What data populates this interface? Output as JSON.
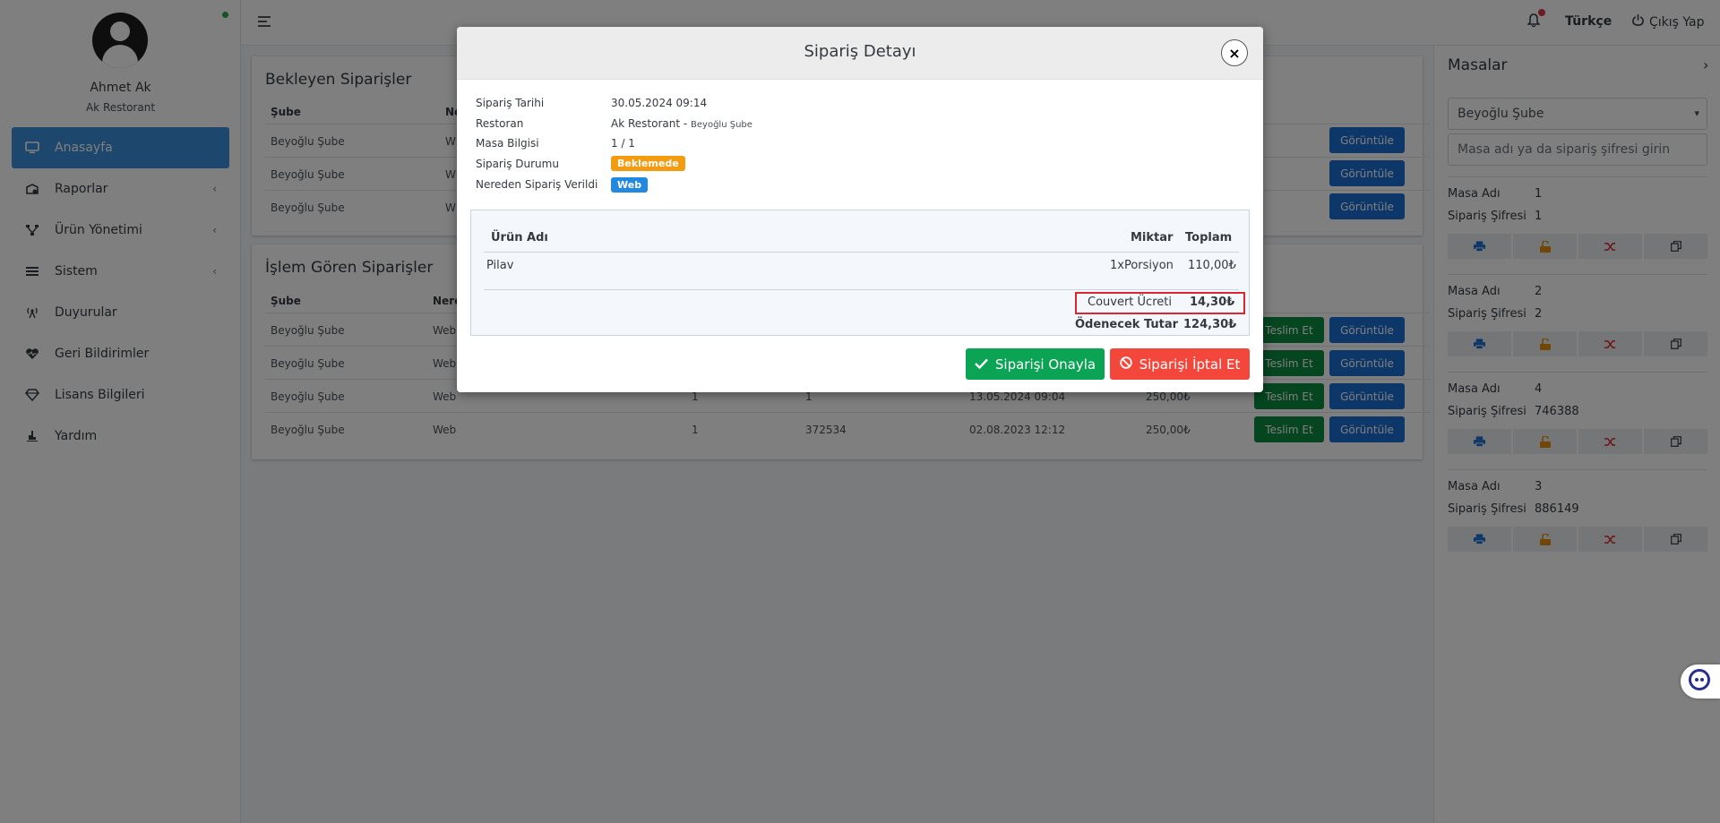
{
  "sidebar": {
    "user_name": "Ahmet Ak",
    "restaurant": "Ak Restorant",
    "items": [
      {
        "label": "Anasayfa",
        "icon": "monitor-icon",
        "active": true
      },
      {
        "label": "Raporlar",
        "icon": "chart-icon"
      },
      {
        "label": "Ürün Yönetimi",
        "icon": "sitemap-icon"
      },
      {
        "label": "Sistem",
        "icon": "list-icon"
      },
      {
        "label": "Duyurular",
        "icon": "broadcast-icon"
      },
      {
        "label": "Geri Bildirimler",
        "icon": "heart-pulse-icon"
      },
      {
        "label": "Lisans Bilgileri",
        "icon": "diamond-icon"
      },
      {
        "label": "Yardım",
        "icon": "hand-icon"
      }
    ]
  },
  "topbar": {
    "language": "Türkçe",
    "logout": "Çıkış Yap"
  },
  "pending": {
    "title": "Bekleyen Siparişler",
    "col_sube": "Şube",
    "col_nereden": "Ne",
    "rows": [
      {
        "sube": "Beyoğlu Şube",
        "from": "W"
      },
      {
        "sube": "Beyoğlu Şube",
        "from": "W"
      },
      {
        "sube": "Beyoğlu Şube",
        "from": "W"
      }
    ],
    "view_label": "Görüntüle"
  },
  "processing": {
    "title": "İşlem Gören Siparişler",
    "col_sube": "Şube",
    "col_nereden": "Nere",
    "rows": [
      {
        "sube": "Beyoğlu Şube",
        "from": "Web",
        "masa": "",
        "sifre": "",
        "date": "",
        "total": ""
      },
      {
        "sube": "Beyoğlu Şube",
        "from": "Web",
        "masa": "",
        "sifre": "",
        "date": "",
        "total": ""
      },
      {
        "sube": "Beyoğlu Şube",
        "from": "Web",
        "masa": "1",
        "sifre": "1",
        "date": "13.05.2024 09:04",
        "total": "250,00₺"
      },
      {
        "sube": "Beyoğlu Şube",
        "from": "Web",
        "masa": "1",
        "sifre": "372534",
        "date": "02.08.2023 12:12",
        "total": "250,00₺"
      }
    ],
    "deliver_label": "Teslim Et",
    "view_label": "Görüntüle"
  },
  "tables_panel": {
    "title": "Masalar",
    "branch": "Beyoğlu Şube",
    "search_placeholder": "Masa adı ya da sipariş şifresi girin",
    "label_name": "Masa Adı",
    "label_code": "Sipariş Şifresi",
    "tables": [
      {
        "name": "1",
        "code": "1"
      },
      {
        "name": "2",
        "code": "2"
      },
      {
        "name": "4",
        "code": "746388"
      },
      {
        "name": "3",
        "code": "886149"
      }
    ]
  },
  "modal": {
    "title": "Sipariş Detayı",
    "close": "×",
    "labels": {
      "date": "Sipariş Tarihi",
      "restaurant": "Restoran",
      "table": "Masa Bilgisi",
      "status": "Sipariş Durumu",
      "source": "Nereden Sipariş Verildi"
    },
    "values": {
      "date": "30.05.2024 09:14",
      "restaurant": "Ak Restorant",
      "restaurant_sep": " - ",
      "branch": "Beyoğlu Şube",
      "table": "1 / 1",
      "status": "Beklemede",
      "source": "Web"
    },
    "items_table": {
      "col_product": "Ürün Adı",
      "col_qty": "Miktar",
      "col_total": "Toplam",
      "items": [
        {
          "product": "Pilav",
          "qty": "1xPorsiyon",
          "total": "110,00₺"
        }
      ],
      "couvert_label": "Couvert Ücreti",
      "couvert_value": "14,30₺",
      "pay_label": "Ödenecek Tutar",
      "pay_value": "124,30₺"
    },
    "approve_label": "Siparişi Onayla",
    "cancel_label": "Siparişi İptal Et"
  }
}
